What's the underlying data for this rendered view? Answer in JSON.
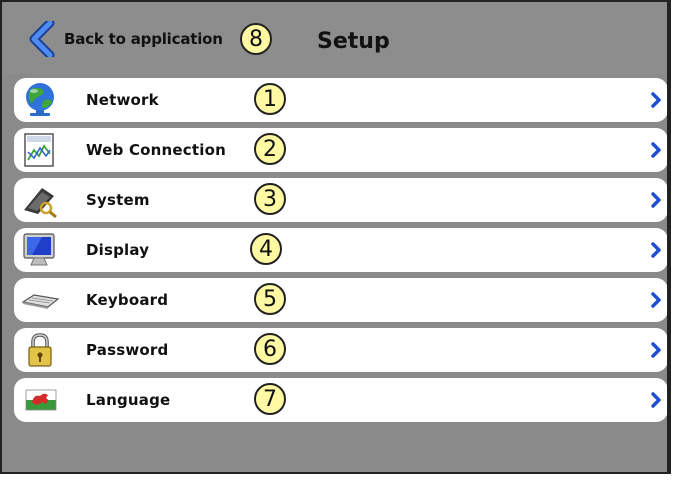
{
  "header": {
    "back_label": "Back to application",
    "back_badge": "8",
    "title": "Setup"
  },
  "items": [
    {
      "label": "Network",
      "badge": "1",
      "icon": "globe-icon"
    },
    {
      "label": "Web Connection",
      "badge": "2",
      "icon": "web-chart-icon"
    },
    {
      "label": "System",
      "badge": "3",
      "icon": "system-tools-icon"
    },
    {
      "label": "Display",
      "badge": "4",
      "icon": "monitor-icon"
    },
    {
      "label": "Keyboard",
      "badge": "5",
      "icon": "keyboard-icon"
    },
    {
      "label": "Password",
      "badge": "6",
      "icon": "padlock-icon"
    },
    {
      "label": "Language",
      "badge": "7",
      "icon": "flag-icon"
    }
  ],
  "colors": {
    "header_bg": "#8d8d8d",
    "badge_fill": "#fff9a3",
    "chevron": "#1f4fd0",
    "back_arrow": "#2a62d6"
  }
}
